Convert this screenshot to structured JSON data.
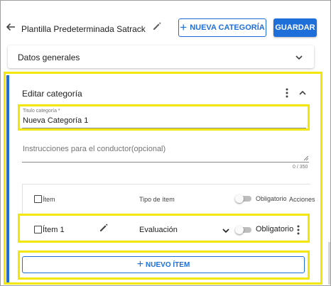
{
  "header": {
    "title": "Plantilla Predeterminada Satrack",
    "new_category_label": "NUEVA CATEGORÍA",
    "save_label": "GUARDAR"
  },
  "general_section": {
    "label": "Datos generales"
  },
  "edit_section": {
    "title": "Editar categoría",
    "category_field": {
      "label": "Titulo categoría *",
      "value": "Nueva Categoría 1"
    },
    "instructions_field": {
      "placeholder": "Instrucciones para el conductor(opcional)",
      "counter": "0 / 350"
    },
    "table": {
      "headers": {
        "item": "Ítem",
        "type": "Tipo de ítem",
        "required": "Obligatorio",
        "actions": "Acciones"
      },
      "rows": [
        {
          "item": "Ítem 1",
          "type": "Evaluación",
          "required_label": "Obligatorio",
          "required_on": false,
          "checked": false
        }
      ]
    },
    "new_item_label": "NUEVO ÍTEM"
  },
  "colors": {
    "accent": "#1e6fd9",
    "highlight": "#f3e600"
  },
  "icons": {
    "back": "arrow-left-icon",
    "edit": "pencil-icon",
    "expand": "chevron-down-icon",
    "collapse": "chevron-up-icon",
    "more": "more-vertical-icon",
    "add": "plus-icon"
  }
}
